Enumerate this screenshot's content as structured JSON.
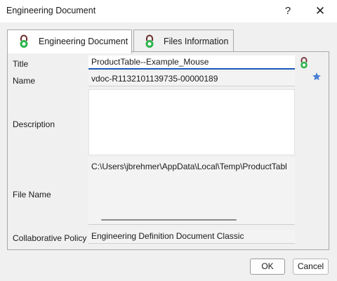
{
  "window": {
    "title": "Engineering Document",
    "help_glyph": "?",
    "close_glyph": "✕"
  },
  "tabs": [
    {
      "label": "Engineering Document",
      "icon": "lock-icon",
      "active": true
    },
    {
      "label": "Files Information",
      "icon": "lock-icon",
      "active": false
    }
  ],
  "form": {
    "title_label": "Title",
    "title_value": "ProductTable--Example_Mouse",
    "name_label": "Name",
    "name_value": "vdoc-R1132101139735-00000189",
    "description_label": "Description",
    "description_value": "",
    "file_name_label": "File Name",
    "file_name_value": "C:\\Users\\jbrehmer\\AppData\\Local\\Temp\\ProductTabl",
    "policy_label": "Collaborative Policy",
    "policy_value": "Engineering Definition Document Classic"
  },
  "icons": {
    "title_lock": "lock-icon",
    "favorite": "star-icon"
  },
  "buttons": {
    "ok_label": "OK",
    "cancel_label": "Cancel"
  },
  "colors": {
    "accent": "#1a58b8",
    "lock_green": "#2db34a",
    "lock_shackle": "#6b2b2b",
    "star": "#4a7fd6"
  }
}
